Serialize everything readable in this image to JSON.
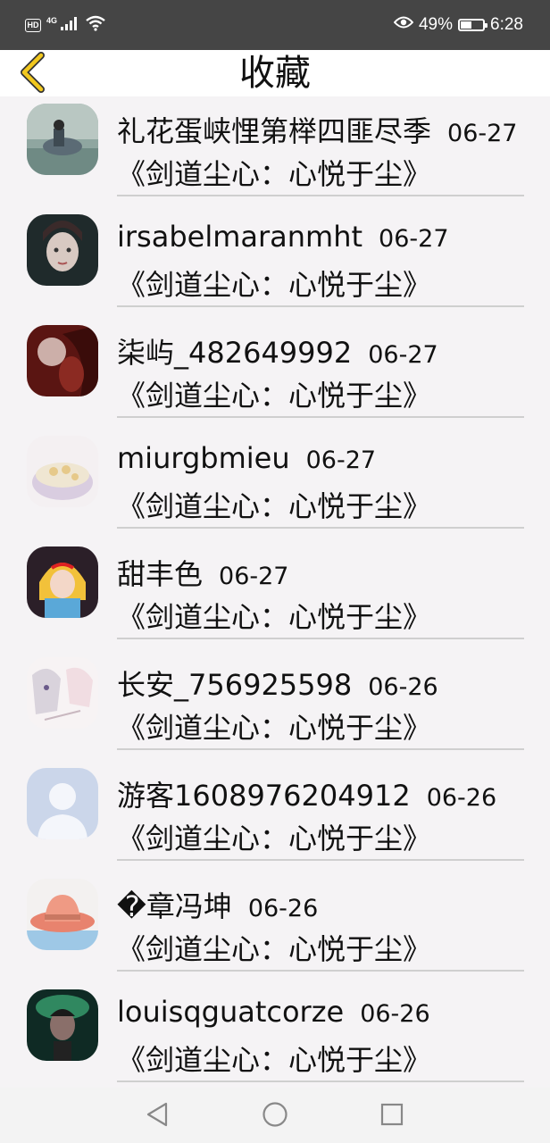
{
  "status_bar": {
    "hd_label": "HD",
    "network_label": "4G",
    "battery_percent": "49%",
    "battery_level": 0.49,
    "time": "6:28",
    "icons": [
      "hd-icon",
      "signal-icon",
      "wifi-icon",
      "eye-icon",
      "battery-icon"
    ]
  },
  "header": {
    "title": "收藏",
    "back_icon": "chevron-left-icon",
    "accent_color": "#f2c81e"
  },
  "items": [
    {
      "name": "礼花蛋峡悝第榉四匪尽季",
      "date": "06-27",
      "book": "《剑道尘心：心悦于尘》",
      "avatar": "photo-lake"
    },
    {
      "name": "irsabelmaranmht",
      "date": "06-27",
      "book": "《剑道尘心：心悦于尘》",
      "avatar": "photo-portrait"
    },
    {
      "name": "柒屿_482649992",
      "date": "06-27",
      "book": "《剑道尘心：心悦于尘》",
      "avatar": "photo-red-art"
    },
    {
      "name": "miurgbmieu",
      "date": "06-27",
      "book": "《剑道尘心：心悦于尘》",
      "avatar": "photo-flowers"
    },
    {
      "name": "甜丰色",
      "date": "06-27",
      "book": "《剑道尘心：心悦于尘》",
      "avatar": "photo-cartoon"
    },
    {
      "name": "长安_756925598",
      "date": "06-26",
      "book": "《剑道尘心：心悦于尘》",
      "avatar": "photo-sketch"
    },
    {
      "name": "游客1608976204912",
      "date": "06-26",
      "book": "《剑道尘心：心悦于尘》",
      "avatar": "default-user"
    },
    {
      "name": "�章冯坤",
      "date": "06-26",
      "book": "《剑道尘心：心悦于尘》",
      "avatar": "photo-hat"
    },
    {
      "name": "louisqguatcorze",
      "date": "06-26",
      "book": "《剑道尘心：心悦于尘》",
      "avatar": "photo-green-light"
    }
  ],
  "nav_bar": {
    "buttons": [
      "back-triangle-icon",
      "home-circle-icon",
      "recents-square-icon"
    ]
  }
}
